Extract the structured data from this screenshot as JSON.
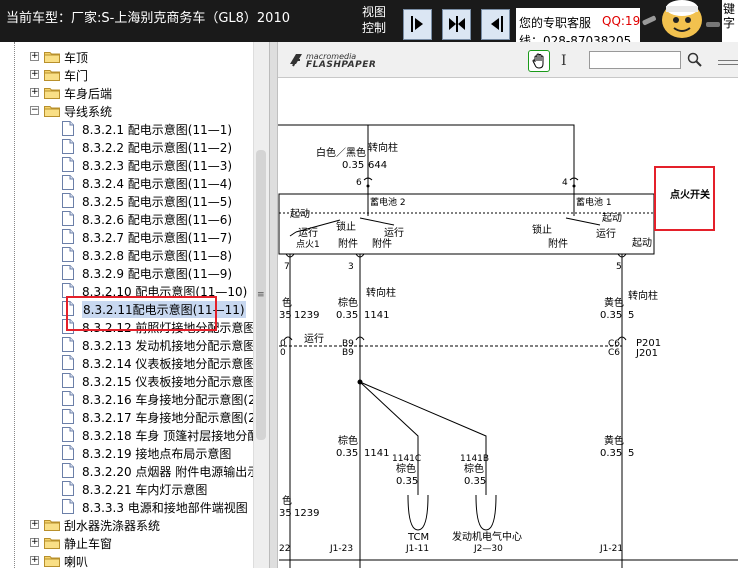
{
  "header": {
    "car_title": "当前车型：厂家:S-上海别克商务车（GL8）2010",
    "view_control": "视图控制",
    "service_label": "您的专职客服",
    "qq_label": "QQ:19",
    "phone_label": "线：028-87038205",
    "side_text_1": "键",
    "side_text_2": "字"
  },
  "tree": {
    "items": [
      {
        "label": "车顶",
        "type": "folder",
        "level": 1,
        "expander": "+"
      },
      {
        "label": "车门",
        "type": "folder",
        "level": 1,
        "expander": "+"
      },
      {
        "label": "车身后端",
        "type": "folder",
        "level": 1,
        "expander": "+"
      },
      {
        "label": "导线系统",
        "type": "folder",
        "level": 1,
        "expander": "−"
      },
      {
        "label": "8.3.2.1 配电示意图(11—1)",
        "type": "doc",
        "level": 2
      },
      {
        "label": "8.3.2.2 配电示意图(11—2)",
        "type": "doc",
        "level": 2
      },
      {
        "label": "8.3.2.3 配电示意图(11—3)",
        "type": "doc",
        "level": 2
      },
      {
        "label": "8.3.2.4 配电示意图(11—4)",
        "type": "doc",
        "level": 2
      },
      {
        "label": "8.3.2.5 配电示意图(11—5)",
        "type": "doc",
        "level": 2
      },
      {
        "label": "8.3.2.6 配电示意图(11—6)",
        "type": "doc",
        "level": 2
      },
      {
        "label": "8.3.2.7 配电示意图(11—7)",
        "type": "doc",
        "level": 2
      },
      {
        "label": "8.3.2.8 配电示意图(11—8)",
        "type": "doc",
        "level": 2
      },
      {
        "label": "8.3.2.9 配电示意图(11—9)",
        "type": "doc",
        "level": 2
      },
      {
        "label": "8.3.2.10 配电示意图(11—10)",
        "type": "doc",
        "level": 2
      },
      {
        "label": "8.3.2.11配电示意图(11—11)",
        "type": "doc",
        "level": 2,
        "selected": true
      },
      {
        "label": "8.3.2.12 前照灯接地分配示意图（",
        "type": "doc",
        "level": 2
      },
      {
        "label": "8.3.2.13 发动机接地分配示意图",
        "type": "doc",
        "level": 2
      },
      {
        "label": "8.3.2.14 仪表板接地分配示意图(2",
        "type": "doc",
        "level": 2
      },
      {
        "label": "8.3.2.15 仪表板接地分配示意图(2",
        "type": "doc",
        "level": 2
      },
      {
        "label": "8.3.2.16 车身接地分配示意图(2—",
        "type": "doc",
        "level": 2
      },
      {
        "label": "8.3.2.17 车身接地分配示意图(2—",
        "type": "doc",
        "level": 2
      },
      {
        "label": "8.3.2.18 车身 顶篷衬层接地分配示",
        "type": "doc",
        "level": 2
      },
      {
        "label": "8.3.2.19 接地点布局示意图",
        "type": "doc",
        "level": 2
      },
      {
        "label": "8.3.2.20 点烟器 附件电源输出示意",
        "type": "doc",
        "level": 2
      },
      {
        "label": "8.3.2.21 车内灯示意图",
        "type": "doc",
        "level": 2
      },
      {
        "label": "8.3.3.3 电源和接地部件端视图",
        "type": "doc",
        "level": 2
      },
      {
        "label": "刮水器洗涤器系统",
        "type": "folder",
        "level": 1,
        "expander": "+"
      },
      {
        "label": "静止车窗",
        "type": "folder",
        "level": 1,
        "expander": "+"
      },
      {
        "label": "喇叭",
        "type": "folder",
        "level": 1,
        "expander": "+"
      }
    ]
  },
  "viewer": {
    "logo_top": "macromedia",
    "logo_bottom": "FLASHPAPER",
    "search_value": ""
  },
  "diagram": {
    "labels": {
      "zhuanxiangzhu_top": "转向柱",
      "wire_top_color": "白色／黑色",
      "wire_top_size": "0.35",
      "wire_top_num": "644",
      "pin_6": "6",
      "pin_4": "4",
      "battery_2": "蓄电池 2",
      "battery_1": "蓄电池 1",
      "qidong_left": "起动",
      "qidong_right": "起动",
      "yunxing_left": "运行",
      "dianhuo1": "点火1",
      "suoding_left": "锁止",
      "yunxing_mid": "运行",
      "fujian_left": "附件",
      "fujian_mid": "附件",
      "suoding_right": "锁止",
      "fujian_right": "附件",
      "yunxing_right": "运行",
      "qidong_bottom": "起动",
      "ignition_switch": "点火开关",
      "pin_7": "7",
      "pin_3": "3",
      "pin_5": "5",
      "left_color_1": "色",
      "left_size_1": "35",
      "left_num_1": "1239",
      "mid_color": "棕色",
      "mid_size": "0.35",
      "mid_num": "1141",
      "zhuanxiangzhu_mid": "转向柱",
      "right_color": "黄色",
      "right_size": "0.35",
      "right_num": "5",
      "zhuanxiangzhu_right": "转向柱",
      "yunxing_b9": "运行",
      "b9_top": "B9",
      "b9_bottom": "B9",
      "c6_top": "C6",
      "c6_bottom": "C6",
      "p201": "P201",
      "j201": "J201",
      "lower_mid_color": "棕色",
      "lower_mid_size": "0.35",
      "lower_mid_num": "1141",
      "w1141c": "1141C",
      "w1141c_color": "棕色",
      "w1141c_size": "0.35",
      "w1141b": "1141B",
      "w1141b_color": "棕色",
      "w1141b_size": "0.35",
      "lower_right_color": "黄色",
      "lower_right_size": "0.35",
      "lower_right_num": "5",
      "lower_left_color": "色",
      "lower_left_size": "35",
      "lower_left_num": "1239",
      "tcm": "TCM",
      "j1_11": "J1-11",
      "ecu": "发动机电气中心",
      "j2_30": "J2—30",
      "j1_23": "J1-23",
      "j1_21": "J1-21",
      "left_0": "0",
      "left_0b": "0",
      "left_22": "22"
    }
  }
}
